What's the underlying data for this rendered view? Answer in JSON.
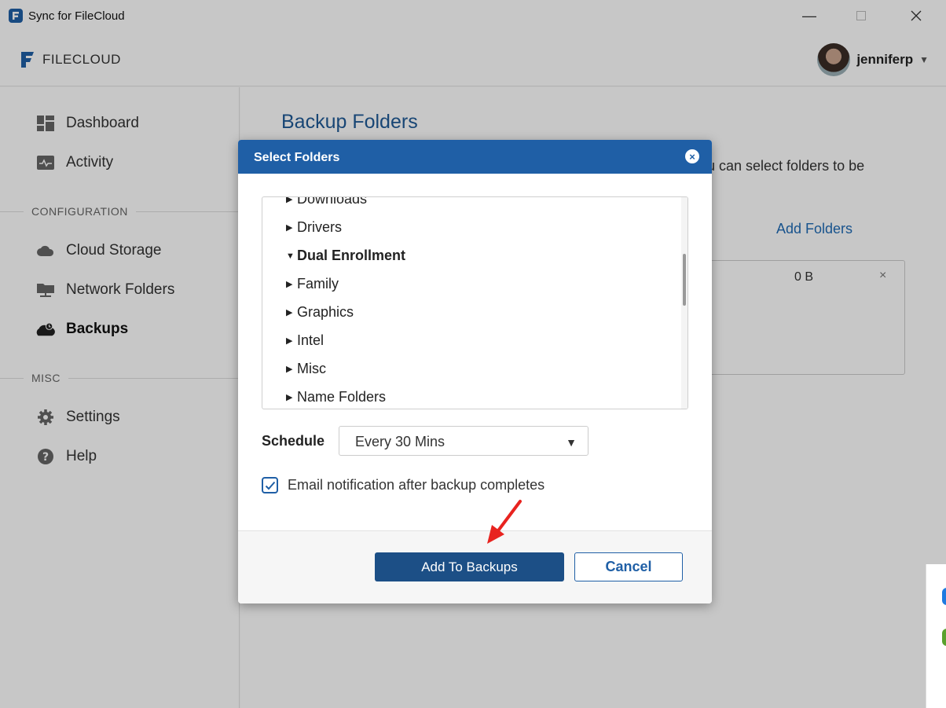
{
  "window": {
    "title": "Sync for FileCloud"
  },
  "header": {
    "brand": "FILECLOUD",
    "username": "jenniferp"
  },
  "sidebar": {
    "items": [
      {
        "label": "Dashboard",
        "icon": "dashboard-icon"
      },
      {
        "label": "Activity",
        "icon": "activity-icon"
      }
    ],
    "config_section": "CONFIGURATION",
    "config_items": [
      {
        "label": "Cloud Storage",
        "icon": "cloud-icon"
      },
      {
        "label": "Network Folders",
        "icon": "network-folder-icon"
      },
      {
        "label": "Backups",
        "icon": "backup-icon",
        "active": true
      }
    ],
    "misc_section": "MISC",
    "misc_items": [
      {
        "label": "Settings",
        "icon": "gear-icon"
      },
      {
        "label": "Help",
        "icon": "help-icon"
      }
    ]
  },
  "main": {
    "title": "Backup Folders",
    "description_fragment": "u can select folders to be",
    "add_folders_label": "Add Folders",
    "entry_size": "0 B",
    "remove_symbol": "×"
  },
  "dialog": {
    "title": "Select Folders",
    "close_symbol": "×",
    "folders": [
      {
        "name": "Downloads",
        "expanded": false
      },
      {
        "name": "Drivers",
        "expanded": false
      },
      {
        "name": "Dual Enrollment",
        "expanded": true
      },
      {
        "name": "Family",
        "expanded": false
      },
      {
        "name": "Graphics",
        "expanded": false
      },
      {
        "name": "Intel",
        "expanded": false
      },
      {
        "name": "Misc",
        "expanded": false
      },
      {
        "name": "Name Folders",
        "expanded": false
      }
    ],
    "schedule_label": "Schedule",
    "schedule_value": "Every 30 Mins",
    "email_notification_label": "Email notification after backup completes",
    "email_notification_checked": true,
    "add_button_label": "Add To Backups",
    "cancel_button_label": "Cancel"
  },
  "colors": {
    "accent": "#1f5fa6",
    "primary_button": "#1c4f86",
    "title_blue": "#1f5a96",
    "annotation_arrow": "#e8231f"
  }
}
